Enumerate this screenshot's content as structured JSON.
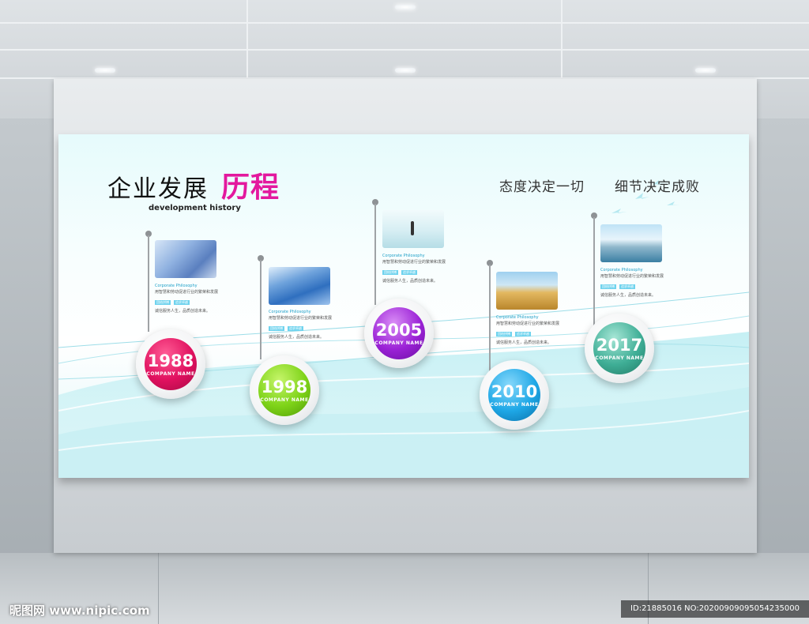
{
  "board": {
    "title": "企业发展",
    "title_highlight": "历程",
    "subtitle": "development history",
    "slogans": [
      "态度决定一切",
      "细节决定成败"
    ]
  },
  "milestones": [
    {
      "year": "1988",
      "company": "COMPANY NAME",
      "color": "#e0115f",
      "caption_en": "Corporate Philosophy",
      "caption_cn": "用智慧和劳动促进行业的繁荣和发展",
      "tags": [
        "团结拼搏",
        "追求卓越"
      ],
      "note": "诚信服务人生，品质创造未来。"
    },
    {
      "year": "1998",
      "company": "COMPANY NAME",
      "color": "#7ed318",
      "caption_en": "Corporate Philosophy",
      "caption_cn": "用智慧和劳动促进行业的繁荣和发展",
      "tags": [
        "团结拼搏",
        "追求卓越"
      ],
      "note": "诚信服务人生，品质创造未来。"
    },
    {
      "year": "2005",
      "company": "COMPANY NAME",
      "color": "#9b22d6",
      "caption_en": "Corporate Philosophy",
      "caption_cn": "用智慧和劳动促进行业的繁荣和发展",
      "tags": [
        "团结拼搏",
        "追求卓越"
      ],
      "note": "诚信服务人生，品质创造未来。"
    },
    {
      "year": "2010",
      "company": "COMPANY NAME",
      "color": "#1ea7e6",
      "caption_en": "Corporate Philosophy",
      "caption_cn": "用智慧和劳动促进行业的繁荣和发展",
      "tags": [
        "团结拼搏",
        "追求卓越"
      ],
      "note": "诚信服务人生，品质创造未来。"
    },
    {
      "year": "2017",
      "company": "COMPANY NAME",
      "color": "#3fae96",
      "caption_en": "Corporate Philosophy",
      "caption_cn": "用智慧和劳动促进行业的繁荣和发展",
      "tags": [
        "团结拼搏",
        "追求卓越"
      ],
      "note": "诚信服务人生，品质创造未来。"
    }
  ],
  "watermark": {
    "left": "昵图网 www.nipic.com",
    "right": "ID:21885016 NO:20200909095054235000"
  }
}
